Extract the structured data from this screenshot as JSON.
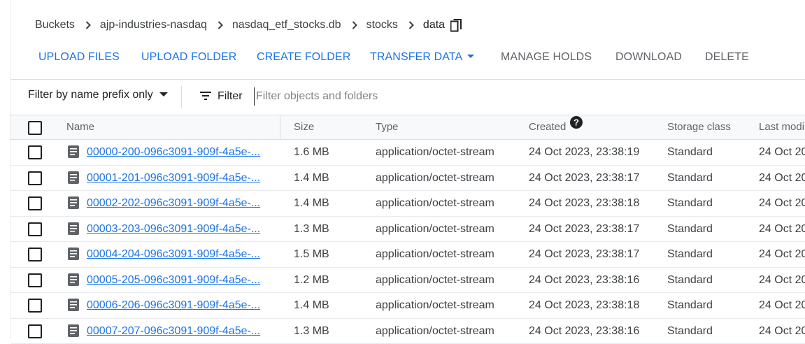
{
  "breadcrumb": {
    "items": [
      "Buckets",
      "ajp-industries-nasdaq",
      "nasdaq_etf_stocks.db",
      "stocks"
    ],
    "current": "data"
  },
  "actions": {
    "upload_files": "UPLOAD FILES",
    "upload_folder": "UPLOAD FOLDER",
    "create_folder": "CREATE FOLDER",
    "transfer_data": "TRANSFER DATA",
    "manage_holds": "MANAGE HOLDS",
    "download": "DOWNLOAD",
    "delete": "DELETE"
  },
  "filter": {
    "prefix_label": "Filter by name prefix only",
    "label": "Filter",
    "placeholder": "Filter objects and folders"
  },
  "table": {
    "columns": {
      "name": "Name",
      "size": "Size",
      "type": "Type",
      "created": "Created",
      "storage_class": "Storage class",
      "last_modified": "Last modi"
    },
    "rows": [
      {
        "name": "00000-200-096c3091-909f-4a5e-...",
        "size": "1.6 MB",
        "type": "application/octet-stream",
        "created": "24 Oct 2023, 23:38:19",
        "storage_class": "Standard",
        "last_modified": "24 Oct 20"
      },
      {
        "name": "00001-201-096c3091-909f-4a5e-...",
        "size": "1.4 MB",
        "type": "application/octet-stream",
        "created": "24 Oct 2023, 23:38:17",
        "storage_class": "Standard",
        "last_modified": "24 Oct 20"
      },
      {
        "name": "00002-202-096c3091-909f-4a5e-...",
        "size": "1.4 MB",
        "type": "application/octet-stream",
        "created": "24 Oct 2023, 23:38:18",
        "storage_class": "Standard",
        "last_modified": "24 Oct 20"
      },
      {
        "name": "00003-203-096c3091-909f-4a5e-...",
        "size": "1.3 MB",
        "type": "application/octet-stream",
        "created": "24 Oct 2023, 23:38:17",
        "storage_class": "Standard",
        "last_modified": "24 Oct 20"
      },
      {
        "name": "00004-204-096c3091-909f-4a5e-...",
        "size": "1.5 MB",
        "type": "application/octet-stream",
        "created": "24 Oct 2023, 23:38:17",
        "storage_class": "Standard",
        "last_modified": "24 Oct 20"
      },
      {
        "name": "00005-205-096c3091-909f-4a5e-...",
        "size": "1.2 MB",
        "type": "application/octet-stream",
        "created": "24 Oct 2023, 23:38:16",
        "storage_class": "Standard",
        "last_modified": "24 Oct 20"
      },
      {
        "name": "00006-206-096c3091-909f-4a5e-...",
        "size": "1.4 MB",
        "type": "application/octet-stream",
        "created": "24 Oct 2023, 23:38:18",
        "storage_class": "Standard",
        "last_modified": "24 Oct 20"
      },
      {
        "name": "00007-207-096c3091-909f-4a5e-...",
        "size": "1.3 MB",
        "type": "application/octet-stream",
        "created": "24 Oct 2023, 23:38:16",
        "storage_class": "Standard",
        "last_modified": "24 Oct 20"
      }
    ]
  },
  "icons": {
    "chevron": "chevron-right-icon",
    "copy": "copy-icon",
    "filter": "filter-list-icon",
    "help": "help-icon",
    "file": "file-icon"
  },
  "colors": {
    "accent": "#1a73e8",
    "muted_action": "#5f6368",
    "header_bg": "#f8f9fa",
    "divider": "#dadce0"
  }
}
